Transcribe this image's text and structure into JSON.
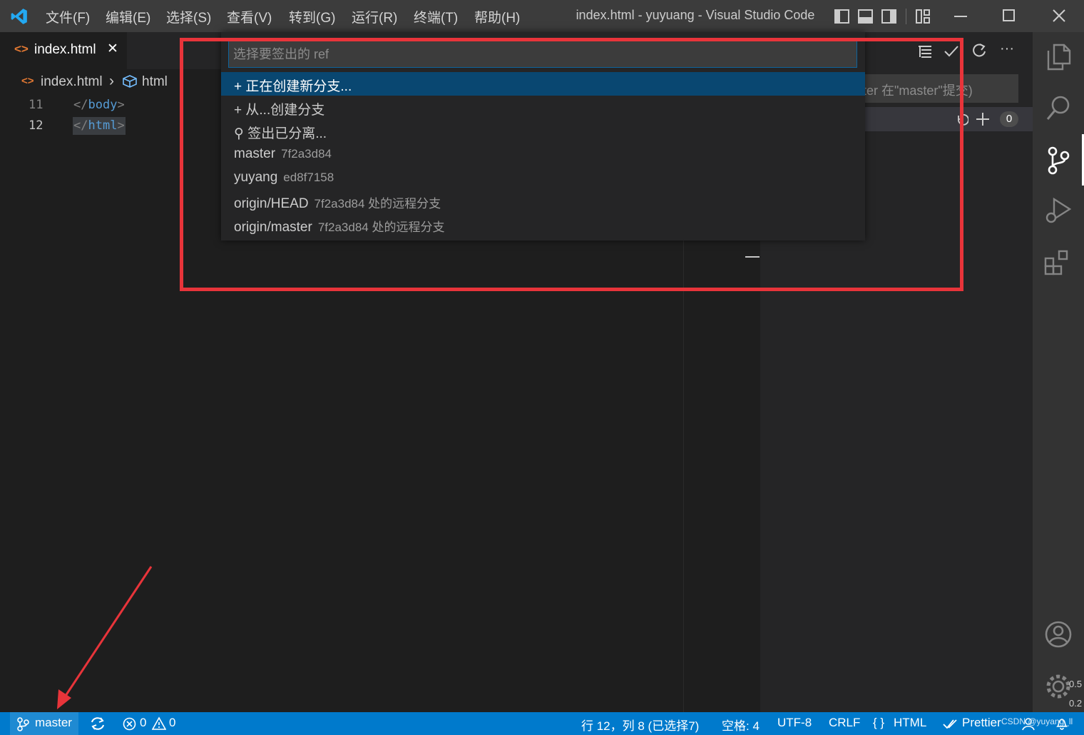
{
  "titlebar": {
    "menu": [
      "文件(F)",
      "编辑(E)",
      "选择(S)",
      "查看(V)",
      "转到(G)",
      "运行(R)",
      "终端(T)",
      "帮助(H)"
    ],
    "window_title": "index.html - yuyuang - Visual Studio Code"
  },
  "tab": {
    "label": "index.html",
    "close_glyph": "✕",
    "icon_glyph": "<>"
  },
  "breadcrumb": {
    "file": "index.html",
    "separator": "›",
    "symbol": "html"
  },
  "editor": {
    "lines": [
      {
        "number": "11",
        "text_open": "</",
        "tag": "body",
        "text_close": ">"
      },
      {
        "number": "12",
        "text_open": "</",
        "tag": "html",
        "text_close": ">"
      }
    ]
  },
  "quick_pick": {
    "placeholder": "选择要签出的 ref",
    "items": [
      {
        "icon": "+",
        "label": "正在创建新分支...",
        "desc": ""
      },
      {
        "icon": "+",
        "label": "从...创建分支",
        "desc": ""
      },
      {
        "icon": "⚲",
        "label": "签出已分离...",
        "desc": ""
      },
      {
        "icon": "",
        "label": "master",
        "desc": "7f2a3d84"
      },
      {
        "icon": "",
        "label": "yuyang",
        "desc": "ed8f7158"
      },
      {
        "icon": "",
        "label": "origin/HEAD",
        "desc": "7f2a3d84 处的远程分支"
      },
      {
        "icon": "",
        "label": "origin/master",
        "desc": "7f2a3d84 处的远程分支"
      }
    ]
  },
  "scm": {
    "commit_placeholder_partial": "ter 在\"master\"提交)",
    "changes_count": "0",
    "toolbar_more": "···"
  },
  "statusbar": {
    "branch": "master",
    "errors": "0",
    "warnings": "0",
    "position": "行 12，列 8 (已选择7)",
    "spaces": "空格: 4",
    "encoding": "UTF-8",
    "eol": "CRLF",
    "language": "HTML",
    "formatter": "Prettier",
    "watermark": "CSDN @yuyang_ll"
  },
  "side_stats": {
    "top": "0.5",
    "bottom": "0.2"
  },
  "colors": {
    "accent": "#007acc",
    "highlight_box": "#e8343a",
    "selection": "#094771"
  }
}
